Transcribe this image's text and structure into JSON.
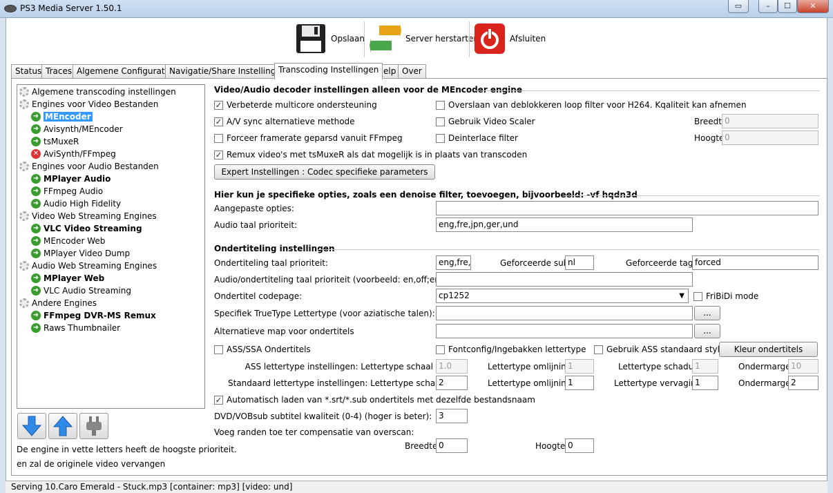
{
  "window": {
    "title": "PS3 Media Server 1.50.1"
  },
  "toolbar": {
    "save": "Opslaan",
    "restart": "Server herstarten",
    "shutdown": "Afsluiten"
  },
  "tabs": [
    "Status",
    "Traces",
    "Algemene Configuratie",
    "Navigatie/Share Instellingen",
    "Transcoding Instellingen",
    "Help",
    "Over"
  ],
  "tree": [
    {
      "label": "Algemene transcoding instellingen",
      "icon": "gear-icon"
    },
    {
      "label": "Engines voor Video Bestanden",
      "icon": "gear-icon"
    },
    {
      "label": "MEncoder",
      "icon": "check-icon",
      "bold": true,
      "selected": true
    },
    {
      "label": "Avisynth/MEncoder",
      "icon": "check-icon"
    },
    {
      "label": "tsMuxeR",
      "icon": "check-icon"
    },
    {
      "label": "AviSynth/FFmpeg",
      "icon": "disabled-icon"
    },
    {
      "label": "Engines voor Audio Bestanden",
      "icon": "gear-icon"
    },
    {
      "label": "MPlayer Audio",
      "icon": "check-icon",
      "bold": true
    },
    {
      "label": "FFmpeg Audio",
      "icon": "check-icon"
    },
    {
      "label": "Audio High Fidelity",
      "icon": "check-icon"
    },
    {
      "label": "Video Web Streaming Engines",
      "icon": "gear-icon"
    },
    {
      "label": "VLC Video Streaming",
      "icon": "check-icon",
      "bold": true
    },
    {
      "label": "MEncoder Web",
      "icon": "check-icon"
    },
    {
      "label": "MPlayer Video Dump",
      "icon": "check-icon"
    },
    {
      "label": "Audio Web Streaming Engines",
      "icon": "gear-icon"
    },
    {
      "label": "MPlayer Web",
      "icon": "check-icon",
      "bold": true
    },
    {
      "label": "VLC Audio Streaming",
      "icon": "check-icon"
    },
    {
      "label": "Andere Engines",
      "icon": "gear-icon"
    },
    {
      "label": "FFmpeg DVR-MS Remux",
      "icon": "check-icon",
      "bold": true
    },
    {
      "label": "Raws Thumbnailer",
      "icon": "check-icon"
    }
  ],
  "notes": {
    "line1": "De engine in vette letters heeft de hoogste prioriteit.",
    "line2": "en zal de originele video vervangen"
  },
  "video": {
    "header": "Video/Audio decoder instellingen alleen voor de MEncoder engine",
    "multicore": "Verbeterde multicore ondersteuning",
    "skiploop": "Overslaan van deblokkeren loop filter voor H264. Kqaliteit kan afnemen",
    "avsync": "A/V sync alternatieve methode",
    "scaler": "Gebruik Video Scaler",
    "width_label": "Breedte",
    "width_value": "0",
    "framerate": "Forceer framerate geparsd vanuit FFmpeg",
    "deinterlace": "Deinterlace filter",
    "height_label": "Hoogte",
    "height_value": "0",
    "remux": "Remux video's met tsMuxeR als dat mogelijk is in plaats van transcoden",
    "expert_btn": "Expert Instellingen : Codec specifieke parameters"
  },
  "custom": {
    "header": "Hier kun je specifieke opties, zoals een denoise filter, toevoegen, bijvoorbeeld: -vf hqdn3d",
    "options_label": "Aangepaste opties:",
    "options_value": "",
    "audio_label": "Audio taal prioriteit:",
    "audio_value": "eng,fre,jpn,ger,und"
  },
  "subs": {
    "header": "Ondertiteling instellingen",
    "lang_label": "Ondertiteling taal prioriteit:",
    "lang_value": "eng,fre,j",
    "forced_sub_label": "Geforceerde sub:",
    "forced_sub_value": "nl",
    "forced_tags_label": "Geforceerde tags:",
    "forced_tags_value": "forced",
    "audiosub_label": "Audio/ondertiteling taal prioriteit (voorbeeld: en,off;eng,off)",
    "audiosub_value": "",
    "codepage_label": "Ondertitel codepage:",
    "codepage_value": "cp1252",
    "fribidi": "FriBiDi mode",
    "truetype_label": "Specifiek TrueType Lettertype (voor aziatische talen):",
    "altdir_label": "Alternatieve map voor ondertitels",
    "browse": "...",
    "ass": "ASS/SSA Ondertitels",
    "fontconfig": "Fontconfig/Ingebakken lettertype",
    "ass_default": "Gebruik ASS standaard style",
    "color_btn": "Kleur ondertitels",
    "ass_font_label": "ASS lettertype instellingen: Lettertype schaal",
    "ass_scale": "1.0",
    "outline_label": "Lettertype omlijning",
    "ass_outline": "1",
    "shadow_label": "Lettertype schaduw",
    "ass_shadow": "1",
    "margin_label": "Ondermarge",
    "ass_margin": "10",
    "std_font_label": "Standaard lettertype instellingen: Lettertype schaal",
    "std_scale": "2",
    "std_outline": "1",
    "blur_label": "Lettertype vervaging",
    "std_blur": "1",
    "std_margin": "2",
    "autoload": "Automatisch laden van *.srt/*.sub ondertitels met dezelfde bestandsnaam",
    "dvd_label": "DVD/VOBsub subtitel kwaliteit (0-4) (hoger is beter):",
    "dvd_value": "3",
    "overscan_label": "Voeg randen toe ter compensatie van overscan:",
    "overscan_width_label": "Breedte",
    "overscan_width": "0",
    "overscan_height_label": "Hoogte",
    "overscan_height": "0"
  },
  "status": {
    "text": "Serving 10.Caro Emerald - Stuck.mp3 [container: mp3] [video: und]"
  },
  "colors": {
    "selection": "#3399ff",
    "ok": "#3a9b2f",
    "error": "#dd3333"
  }
}
